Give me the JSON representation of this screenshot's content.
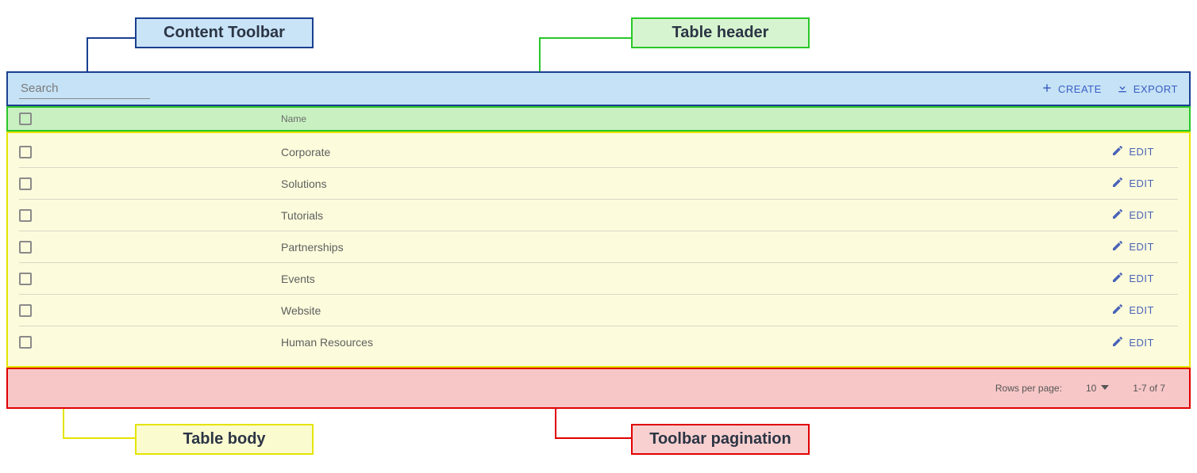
{
  "callouts": {
    "toolbar": "Content Toolbar",
    "header": "Table header",
    "body": "Table body",
    "pagination": "Toolbar pagination"
  },
  "toolbar": {
    "search_placeholder": "Search",
    "create_label": "CREATE",
    "export_label": "EXPORT"
  },
  "table": {
    "header_name": "Name",
    "edit_label": "EDIT",
    "rows": [
      {
        "name": "Corporate"
      },
      {
        "name": "Solutions"
      },
      {
        "name": "Tutorials"
      },
      {
        "name": "Partnerships"
      },
      {
        "name": "Events"
      },
      {
        "name": "Website"
      },
      {
        "name": "Human Resources"
      }
    ]
  },
  "pagination": {
    "rows_per_page_label": "Rows per page:",
    "page_size": "10",
    "range": "1-7 of 7"
  }
}
